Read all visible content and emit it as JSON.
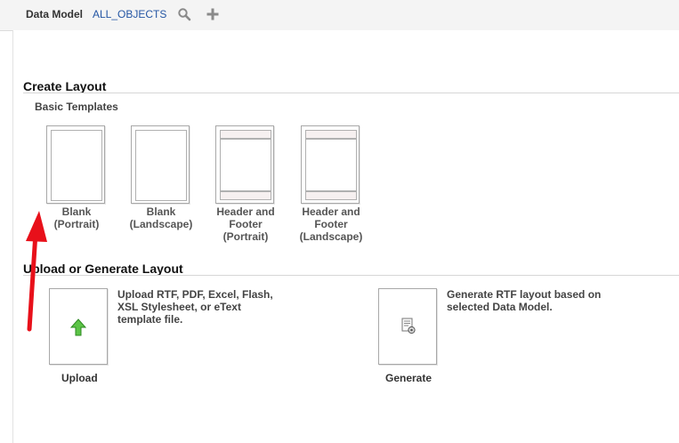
{
  "toolbar": {
    "data_model_label": "Data Model",
    "data_model_value": "ALL_OBJECTS",
    "search_icon": "search-icon",
    "add_icon": "plus-icon"
  },
  "create_layout": {
    "title": "Create Layout",
    "subtitle": "Basic Templates",
    "templates": [
      {
        "label": "Blank\n(Portrait)",
        "type": "blank-portrait"
      },
      {
        "label": "Blank\n(Landscape)",
        "type": "blank-landscape"
      },
      {
        "label": "Header and\nFooter\n(Portrait)",
        "type": "header-footer-portrait"
      },
      {
        "label": "Header and\nFooter\n(Landscape)",
        "type": "header-footer-landscape"
      }
    ]
  },
  "upload_generate": {
    "title": "Upload or Generate Layout",
    "upload": {
      "label": "Upload",
      "description": "Upload RTF, PDF, Excel, Flash,\nXSL Stylesheet, or eText\ntemplate file.",
      "icon": "upload-arrow-icon"
    },
    "generate": {
      "label": "Generate",
      "description": "Generate RTF layout based on\nselected Data Model.",
      "icon": "generate-document-icon"
    }
  },
  "colors": {
    "link": "#2456a4",
    "annotation_arrow": "#e8101a",
    "upload_arrow": "#3aa72a"
  }
}
